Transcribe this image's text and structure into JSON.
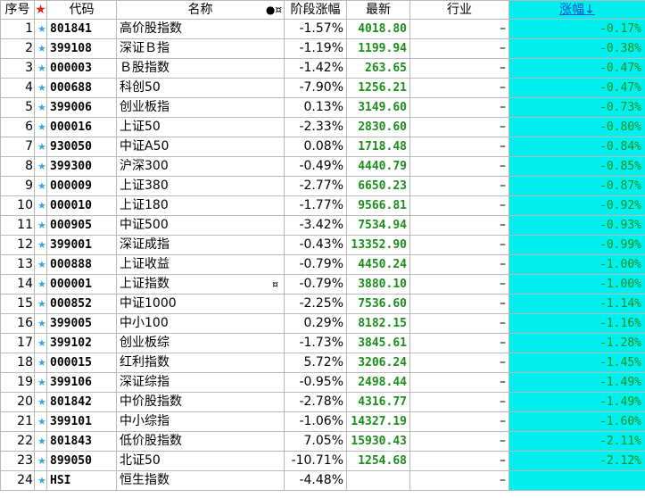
{
  "header": {
    "index": "序号",
    "star": "★",
    "code": "代码",
    "name": "名称",
    "flags": "●¤",
    "stage_change": "阶段涨幅",
    "latest": "最新",
    "industry": "行业",
    "change": "涨幅↓"
  },
  "rows": [
    {
      "idx": "1",
      "code": "801841",
      "name": "高价股指数",
      "stage": "-1.57%",
      "price": "4018.80",
      "industry": "–",
      "change": "-0.17%"
    },
    {
      "idx": "2",
      "code": "399108",
      "name": "深证Ｂ指",
      "stage": "-1.19%",
      "price": "1199.94",
      "industry": "–",
      "change": "-0.38%"
    },
    {
      "idx": "3",
      "code": "000003",
      "name": "Ｂ股指数",
      "stage": "-1.42%",
      "price": "263.65",
      "industry": "–",
      "change": "-0.47%"
    },
    {
      "idx": "4",
      "code": "000688",
      "name": "科创50",
      "stage": "-7.90%",
      "price": "1256.21",
      "industry": "–",
      "change": "-0.47%"
    },
    {
      "idx": "5",
      "code": "399006",
      "name": "创业板指",
      "stage": "0.13%",
      "price": "3149.60",
      "industry": "–",
      "change": "-0.73%"
    },
    {
      "idx": "6",
      "code": "000016",
      "name": "上证50",
      "stage": "-2.33%",
      "price": "2830.60",
      "industry": "–",
      "change": "-0.80%"
    },
    {
      "idx": "7",
      "code": "930050",
      "name": "中证A50",
      "stage": "0.08%",
      "price": "1718.48",
      "industry": "–",
      "change": "-0.84%"
    },
    {
      "idx": "8",
      "code": "399300",
      "name": "沪深300",
      "stage": "-0.49%",
      "price": "4440.79",
      "industry": "–",
      "change": "-0.85%"
    },
    {
      "idx": "9",
      "code": "000009",
      "name": "上证380",
      "stage": "-2.77%",
      "price": "6650.23",
      "industry": "–",
      "change": "-0.87%"
    },
    {
      "idx": "10",
      "code": "000010",
      "name": "上证180",
      "stage": "-1.77%",
      "price": "9566.81",
      "industry": "–",
      "change": "-0.92%"
    },
    {
      "idx": "11",
      "code": "000905",
      "name": "中证500",
      "stage": "-3.42%",
      "price": "7534.94",
      "industry": "–",
      "change": "-0.93%"
    },
    {
      "idx": "12",
      "code": "399001",
      "name": "深证成指",
      "stage": "-0.43%",
      "price": "13352.90",
      "industry": "–",
      "change": "-0.99%"
    },
    {
      "idx": "13",
      "code": "000888",
      "name": "上证收益",
      "stage": "-0.79%",
      "price": "4450.24",
      "industry": "–",
      "change": "-1.00%"
    },
    {
      "idx": "14",
      "code": "000001",
      "name": "上证指数",
      "stage": "-0.79%",
      "price": "3880.10",
      "industry": "–",
      "change": "-1.00%",
      "flag": "¤"
    },
    {
      "idx": "15",
      "code": "000852",
      "name": "中证1000",
      "stage": "-2.25%",
      "price": "7536.60",
      "industry": "–",
      "change": "-1.14%"
    },
    {
      "idx": "16",
      "code": "399005",
      "name": "中小100",
      "stage": "0.29%",
      "price": "8182.15",
      "industry": "–",
      "change": "-1.16%"
    },
    {
      "idx": "17",
      "code": "399102",
      "name": "创业板综",
      "stage": "-1.73%",
      "price": "3845.61",
      "industry": "–",
      "change": "-1.28%"
    },
    {
      "idx": "18",
      "code": "000015",
      "name": "红利指数",
      "stage": "5.72%",
      "price": "3206.24",
      "industry": "–",
      "change": "-1.45%"
    },
    {
      "idx": "19",
      "code": "399106",
      "name": "深证综指",
      "stage": "-0.95%",
      "price": "2498.44",
      "industry": "–",
      "change": "-1.49%"
    },
    {
      "idx": "20",
      "code": "801842",
      "name": "中价股指数",
      "stage": "-2.78%",
      "price": "4316.77",
      "industry": "–",
      "change": "-1.49%"
    },
    {
      "idx": "21",
      "code": "399101",
      "name": "中小综指",
      "stage": "-1.06%",
      "price": "14327.19",
      "industry": "–",
      "change": "-1.60%"
    },
    {
      "idx": "22",
      "code": "801843",
      "name": "低价股指数",
      "stage": "7.05%",
      "price": "15930.43",
      "industry": "–",
      "change": "-2.11%"
    },
    {
      "idx": "23",
      "code": "899050",
      "name": "北证50",
      "stage": "-10.71%",
      "price": "1254.68",
      "industry": "–",
      "change": "-2.12%"
    },
    {
      "idx": "24",
      "code": "HSI",
      "name": "恒生指数",
      "stage": "-4.48%",
      "price": "",
      "industry": "–",
      "change": ""
    }
  ],
  "colors": {
    "price_green": "#1a8f1a",
    "change_bg": "#00f0f0",
    "star_blue": "#3aa6e0",
    "header_star_red": "#e02020"
  }
}
